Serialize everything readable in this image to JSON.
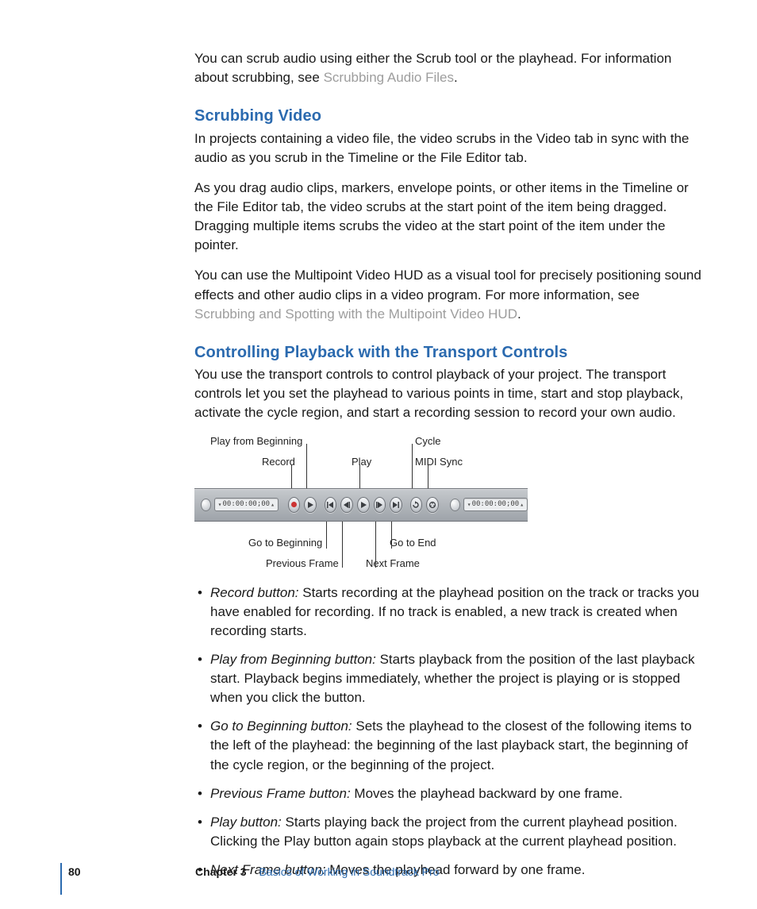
{
  "intro": {
    "p1a": "You can scrub audio using either the Scrub tool or the playhead. For information about scrubbing, see ",
    "p1link": "Scrubbing Audio Files",
    "p1b": "."
  },
  "sec1": {
    "title": "Scrubbing Video",
    "p1": "In projects containing a video file, the video scrubs in the Video tab in sync with the audio as you scrub in the Timeline or the File Editor tab.",
    "p2": "As you drag audio clips, markers, envelope points, or other items in the Timeline or the File Editor tab, the video scrubs at the start point of the item being dragged. Dragging multiple items scrubs the video at the start point of the item under the pointer.",
    "p3a": "You can use the Multipoint Video HUD as a visual tool for precisely positioning sound effects and other audio clips in a video program. For more information, see ",
    "p3link": "Scrubbing and Spotting with the Multipoint Video HUD",
    "p3b": "."
  },
  "sec2": {
    "title": "Controlling Playback with the Transport Controls",
    "p1": "You use the transport controls to control playback of your project. The transport controls let you set the playhead to various points in time, start and stop playback, activate the cycle region, and start a recording session to record your own audio."
  },
  "diagram": {
    "labels": {
      "play_from_beginning": "Play from Beginning",
      "record": "Record",
      "play": "Play",
      "cycle": "Cycle",
      "midi_sync": "MIDI Sync",
      "go_to_beginning": "Go to Beginning",
      "previous_frame": "Previous Frame",
      "next_frame": "Next Frame",
      "go_to_end": "Go to End"
    },
    "timecode": "00:00:00;00"
  },
  "bullets": [
    {
      "term": "Record button:",
      "desc": "  Starts recording at the playhead position on the track or tracks you have enabled for recording. If no track is enabled, a new track is created when recording starts."
    },
    {
      "term": "Play from Beginning button:",
      "desc": "  Starts playback from the position of the last playback start. Playback begins immediately, whether the project is playing or is stopped when you click the button."
    },
    {
      "term": "Go to Beginning button:",
      "desc": "  Sets the playhead to the closest of the following items to the left of the playhead: the beginning of the last playback start, the beginning of the cycle region, or the beginning of the project."
    },
    {
      "term": "Previous Frame button:",
      "desc": "  Moves the playhead backward by one frame."
    },
    {
      "term": "Play button:",
      "desc": "  Starts playing back the project from the current playhead position. Clicking the Play button again stops playback at the current playhead position."
    },
    {
      "term": "Next Frame button:",
      "desc": "  Moves the playhead forward by one frame."
    }
  ],
  "footer": {
    "page": "80",
    "chapter": "Chapter 3",
    "title": "Basics of Working in Soundtrack Pro"
  }
}
